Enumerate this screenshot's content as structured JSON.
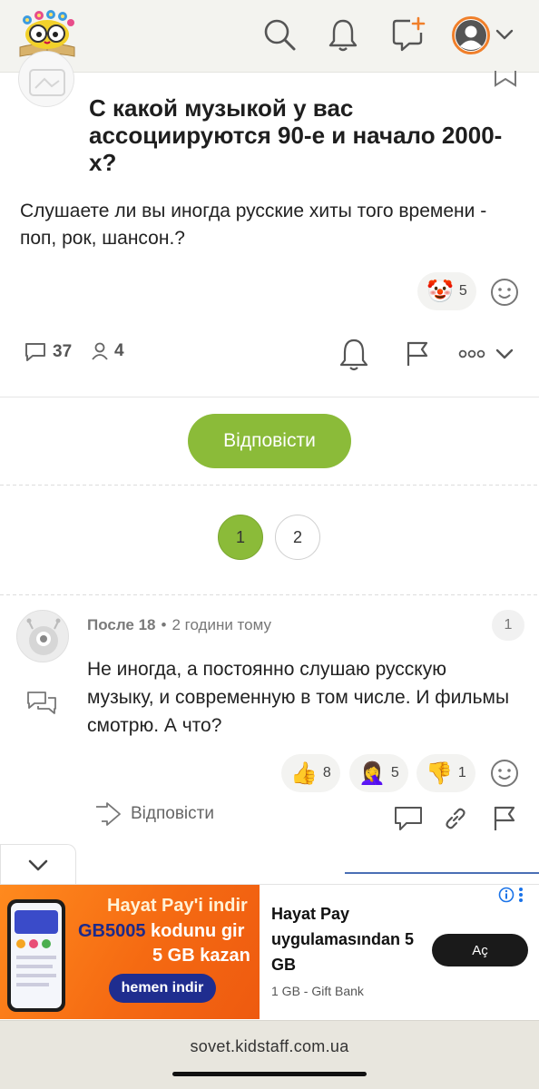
{
  "header": {
    "logo_icon": "kidstaff-owl-logo",
    "icons": [
      "search-icon",
      "bell-icon",
      "new-post-icon",
      "user-avatar-icon",
      "chevron-down-icon"
    ],
    "accent": "#f07f2a"
  },
  "question": {
    "title": "С какой музыкой у вас ассоциируются 90-е и начало 2000-х?",
    "body": "Слушаете ли вы иногда русские хиты того времени - поп, рок, шансон.?",
    "reactions": [
      {
        "emoji": "🤡",
        "count": "5"
      }
    ],
    "comments_count": "37",
    "participants_count": "4"
  },
  "answer_button": {
    "label": "Відповісти",
    "color": "#8bbb39"
  },
  "pagination": {
    "pages": [
      "1",
      "2"
    ],
    "current": "1"
  },
  "comment": {
    "author": "После 18",
    "separator": "•",
    "time": "2 години тому",
    "number": "1",
    "text": "Не иногда, а постоянно слушаю русскую музыку, и современную в том числе. И фильмы смотрю. А что?",
    "reactions": [
      {
        "emoji": "👍",
        "count": "8"
      },
      {
        "emoji": "🤦‍♀️",
        "count": "5"
      },
      {
        "emoji": "👎",
        "count": "1"
      }
    ],
    "reply_label": "Відповісти"
  },
  "ad": {
    "image_line1": "Hayat Pay'i indir",
    "image_promo": "GB5005",
    "image_line2_rest": " kodunu gir",
    "image_line3": "5 GB kazan",
    "image_cta": "hemen indir",
    "title": "Hayat Pay uygulamasından 5 GB",
    "source": "1 GB - Gift Bank",
    "open_label": "Aç"
  },
  "browser": {
    "url": "sovet.kidstaff.com.ua"
  }
}
